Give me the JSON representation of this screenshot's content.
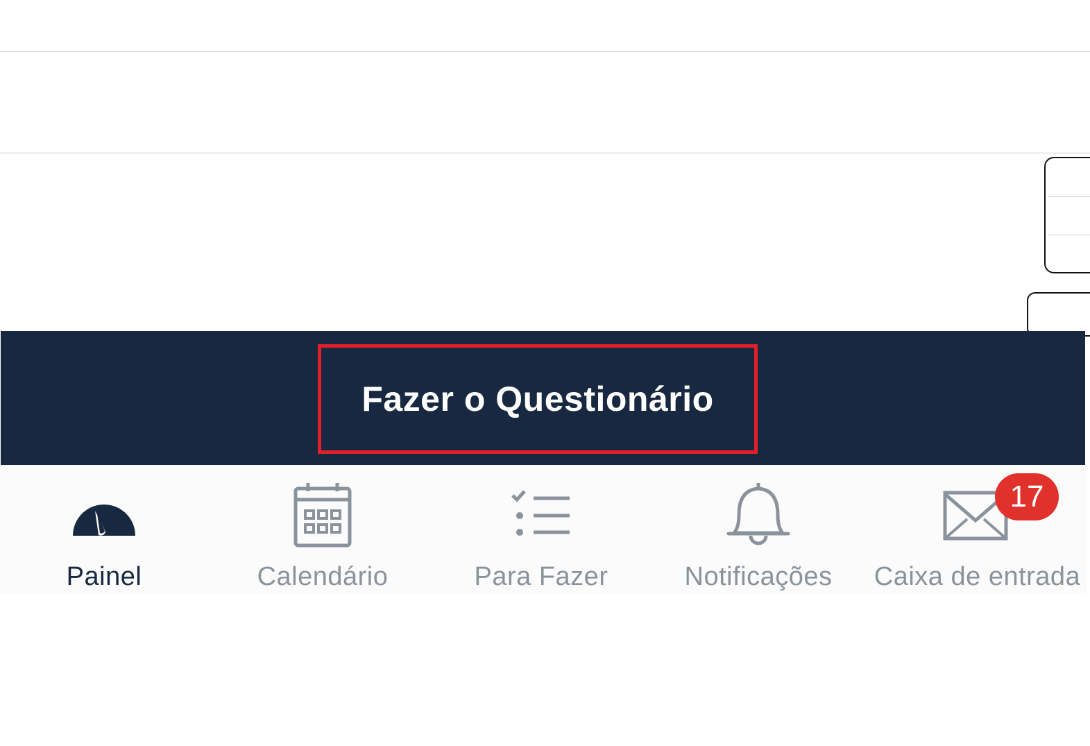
{
  "cta": {
    "label": "Fazer o Questionário"
  },
  "tabbar": {
    "items": [
      {
        "label": "Painel",
        "icon": "dashboard-gauge-icon",
        "active": true
      },
      {
        "label": "Calendário",
        "icon": "calendar-icon",
        "active": false
      },
      {
        "label": "Para Fazer",
        "icon": "checklist-icon",
        "active": false
      },
      {
        "label": "Notificações",
        "icon": "bell-icon",
        "active": false
      },
      {
        "label": "Caixa de entrada",
        "icon": "envelope-icon",
        "active": false,
        "badge": "17"
      }
    ]
  },
  "colors": {
    "cta_background": "#172840",
    "highlight_border": "#e0212b",
    "active_tab": "#172840",
    "inactive_tab": "#8a939c",
    "badge": "#e0312b"
  }
}
